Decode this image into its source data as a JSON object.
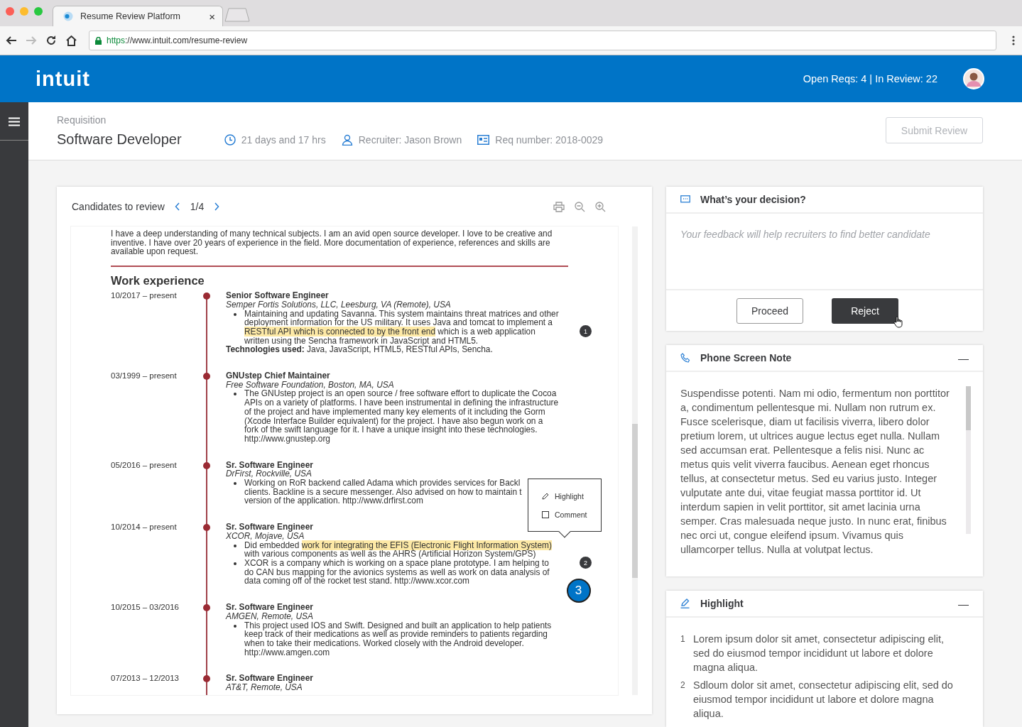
{
  "browser": {
    "tab_title": "Resume Review Platform",
    "tab_close": "×",
    "url": {
      "scheme": "https",
      "rest": "://www.intuit.com/resume-review"
    },
    "forward_disabled": true
  },
  "header": {
    "logo": "intuit",
    "stats": "Open Reqs: 4 | In Review: 22"
  },
  "requisition": {
    "label": "Requisition",
    "title": "Software Developer",
    "meta": [
      {
        "kind": "time",
        "text": "21 days and 17 hrs"
      },
      {
        "kind": "recruiter",
        "text": "Recruiter: Jason Brown"
      },
      {
        "kind": "req",
        "text": "Req number: 2018-0029"
      }
    ],
    "submit": {
      "label": "Submit Review",
      "disabled": true
    }
  },
  "candidates": {
    "title": "Candidates to review",
    "pager": "1/4",
    "resume": {
      "intro": "I have a deep understanding of many technical subjects. I am an avid open source developer. I love to be creative and inventive. I have over 20 years of experience in the field. More documentation of experience, references and skills are available upon request.",
      "section": "Work experience",
      "entries": [
        {
          "dates": "10/2017 – present",
          "role": "Senior Software Engineer",
          "company": "Semper Fortis Solutions, LLC, Leesburg, VA (Remote), USA",
          "bullets": [
            [
              "Maintaining and updating Savanna. This system maintains threat matrices and other",
              "deployment information for the US military. It uses Java and tomcat to implement a",
              {
                "parts": [
                  {
                    "text": "RESTful API which is connected to by the front end",
                    "highlighted": true
                  },
                  {
                    "text": " which is a web application",
                    "highlighted": false
                  }
                ]
              },
              "written using the Sencha framework in JavaScript and HTML5."
            ]
          ],
          "tech": "**Technologies used:** Java, JavaScript, HTML5, RESTful APIs, Sencha.",
          "markers": [
            {
              "label": "1",
              "selected": false
            }
          ]
        },
        {
          "dates": "03/1999 – present",
          "role": "GNUstep Chief Maintainer",
          "company": "Free Software Foundation, Boston, MA, USA",
          "bullets": [
            [
              "The GNUstep project is an open source / free software effort to duplicate the Cocoa",
              "APIs on a variety of platforms. I have been instrumental in defining the infrastructure",
              "of the project and have implemented many key elements of it including the Gorm",
              "(Xcode Interface Builder equivalent) for the project. I have also begun work on a",
              "fork of the swift language for it. I have a unique insight into these technologies.",
              "http://www.gnustep.org"
            ]
          ]
        },
        {
          "dates": "05/2016 – present",
          "role": "Sr. Software Engineer",
          "company": "DrFirst, Rockville, USA",
          "bullets": [
            [
              "Working on RoR backend called Adama which provides services for Backl",
              "clients. Backline is a secure messenger. Also advised on how to maintain t",
              "version of the application. http://www.drfirst.com"
            ]
          ]
        },
        {
          "dates": "10/2014 – present",
          "role": "Sr. Software Engineer",
          "company": "XCOR, Mojave, USA",
          "bullets": [
            [
              {
                "parts": [
                  {
                    "text": "Did embedded ",
                    "highlighted": false
                  },
                  {
                    "text": "work for integrating the EFIS (Electronic Flight Information System)",
                    "highlighted": true
                  }
                ]
              },
              "with various components as well as the AHRS (Artificial Horizon System/GPS)"
            ],
            [
              "XCOR is a company which is working on a space plane prototype.  I am helping to",
              "do CAN bus mapping for the avionics systems as well as work on data analysis of",
              "data coming off of the rocket test stand.  http://www.xcor.com"
            ]
          ],
          "markers": [
            {
              "label": "2",
              "selected": false
            },
            {
              "label": "3",
              "selected": true
            }
          ]
        },
        {
          "dates": "10/2015 – 03/2016",
          "role": "Sr. Software Engineer",
          "company": "AMGEN, Remote, USA",
          "bullets": [
            [
              "This project used IOS and Swift. Designed and built an application to help patients",
              "keep track of their medications as well as provide reminders to patients regarding",
              "when to take their medications.  Worked closely with the Android developer.",
              "http://www.amgen.com"
            ]
          ]
        },
        {
          "dates": "07/2013 – 12/2013",
          "role": "Sr. Software Engineer",
          "company": "AT&T, Remote, USA"
        }
      ]
    },
    "popover": [
      {
        "kind": "highlight",
        "label": "Highlight"
      },
      {
        "kind": "comment",
        "label": "Comment"
      }
    ]
  },
  "decision": {
    "title": "What’s your decision?",
    "placeholder": "Your feedback will help recruiters to find better candidate",
    "buttons": [
      {
        "kind": "secondary",
        "label": "Proceed"
      },
      {
        "kind": "primary",
        "label": "Reject"
      }
    ]
  },
  "phone_note": {
    "title": "Phone Screen Note",
    "collapse": "—",
    "text": "Suspendisse potenti. Nam mi odio, fermentum non porttitor a, condimentum pellentesque mi. Nullam non rutrum ex. Fusce scelerisque, diam ut facilisis viverra, libero dolor pretium lorem, ut ultrices augue lectus eget nulla. Nullam sed accumsan erat. Pellentesque a felis nisi. Nunc ac metus quis velit viverra faucibus. Aenean eget rhoncus tellus, at consectetur metus. Sed eu varius justo. Integer vulputate ante dui, vitae feugiat massa porttitor id. Ut interdum sapien in velit porttitor, sit amet lacinia urna semper. Cras malesuada neque justo. In nunc erat, finibus nec orci ut, congue eleifend ipsum. Vivamus quis ullamcorper tellus. Nulla at volutpat lectus."
  },
  "highlight": {
    "title": "Highlight",
    "collapse": "—",
    "items": [
      {
        "number": "1",
        "text": "Lorem ipsum dolor sit amet, consectetur adipiscing elit, sed do eiusmod tempor incididunt ut labore et dolore magna aliqua."
      },
      {
        "number": "2",
        "text": "Sdloum dolor sit amet, consectetur adipiscing elit, sed do eiusmod tempor incididunt ut labore et dolore magna aliqua."
      }
    ]
  }
}
